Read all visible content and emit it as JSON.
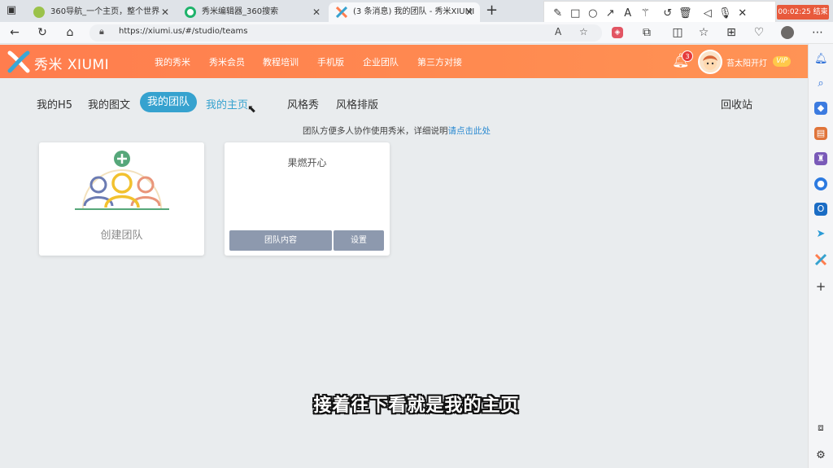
{
  "browser": {
    "tabs": [
      {
        "label": "360导航_一个主页，整个世界"
      },
      {
        "label": "秀米编辑器_360搜索"
      },
      {
        "label": "(3 条消息) 我的团队 - 秀米XIUMI",
        "active": true
      }
    ],
    "new_tab": "+",
    "url": "https://xiumi.us/#/studio/teams"
  },
  "recorder": {
    "time": "00:02:25",
    "stop_label": "结束"
  },
  "site": {
    "logo_text": "秀米 XIUMI",
    "nav": [
      "我的秀米",
      "秀米会员",
      "教程培训",
      "手机版",
      "企业团队",
      "第三方对接"
    ],
    "notification_count": "3",
    "user_name": "苔太阳开灯",
    "vip_label": "VIP"
  },
  "studio": {
    "tabs": [
      {
        "label": "我的H5"
      },
      {
        "label": "我的图文"
      },
      {
        "label": "我的团队",
        "active": true
      },
      {
        "label": "我的主页",
        "hover": true
      },
      {
        "label": "风格秀"
      },
      {
        "label": "风格排版"
      }
    ],
    "recycle": "回收站",
    "tip_text": "团队方便多人协作使用秀米，详细说明",
    "tip_link": "请点击此处"
  },
  "cards": {
    "create_label": "创建团队",
    "team": {
      "name": "果燃开心",
      "content_button": "团队内容",
      "settings_button": "设置"
    }
  },
  "subtitle": "接着往下看就是我的主页",
  "colors": {
    "header": "#ff8550",
    "accent": "#36a2cf",
    "card_button": "#8d99ae"
  }
}
